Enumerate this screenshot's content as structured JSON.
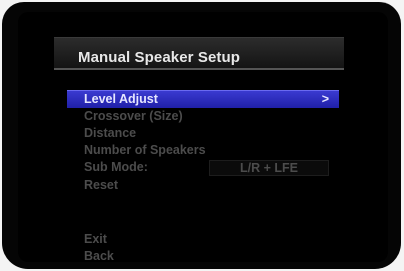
{
  "menu": {
    "title": "Manual Speaker Setup",
    "items": [
      {
        "label": "Level Adjust",
        "selected": true,
        "chevron": ">"
      },
      {
        "label": "Crossover (Size)"
      },
      {
        "label": "Distance"
      },
      {
        "label": "Number of Speakers"
      },
      {
        "label": "Sub Mode:",
        "value": "L/R + LFE"
      },
      {
        "label": "Reset"
      }
    ],
    "footer": [
      {
        "label": "Exit"
      },
      {
        "label": "Back"
      }
    ]
  },
  "colors": {
    "highlight": "#2828b8",
    "text_active": "#e6e6ff",
    "text_inactive": "#4c4c4c",
    "title_text": "#e8e8e8"
  }
}
